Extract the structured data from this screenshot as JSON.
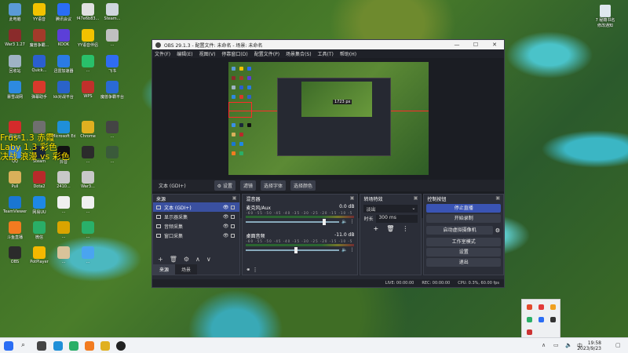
{
  "desktop": {
    "icons": [
      {
        "label": "此电脑",
        "color": "#5a9ad6"
      },
      {
        "label": "YY语音",
        "color": "#f2c200"
      },
      {
        "label": "腾讯会议",
        "color": "#2a6df4"
      },
      {
        "label": "f47e6b83...",
        "color": "#e0e0e0"
      },
      {
        "label": "Steam...",
        "color": "#cfd6dd"
      },
      {
        "label": "War3 1.27",
        "color": "#8a2b2b"
      },
      {
        "label": "魔兽争霸...",
        "color": "#a33a2a"
      },
      {
        "label": "KOOK",
        "color": "#5c3fd8"
      },
      {
        "label": "YY语音伴侣",
        "color": "#f2c200"
      },
      {
        "label": "...",
        "color": "#c0c0c0"
      },
      {
        "label": "回收站",
        "color": "#9fb3c4"
      },
      {
        "label": "Quick...",
        "color": "#2b5fcf"
      },
      {
        "label": "迅雷加速器",
        "color": "#2a7be4"
      },
      {
        "label": "...",
        "color": "#29c06a"
      },
      {
        "label": "飞书",
        "color": "#2f6cf2"
      },
      {
        "label": "暴雪战网",
        "color": "#2d8ae0"
      },
      {
        "label": "弹幕助手",
        "color": "#d8392b"
      },
      {
        "label": "kk对战平台",
        "color": "#2a63c9"
      },
      {
        "label": "WPS",
        "color": "#c0302b"
      },
      {
        "label": "魔兽争霸平台",
        "color": "#2a6ad4"
      },
      {
        "label": "网易云",
        "color": "#d42b2b"
      },
      {
        "label": "...",
        "color": "#6f6f6f"
      },
      {
        "label": "Microsoft Edge",
        "color": "#1f8fd8"
      },
      {
        "label": "Chrome",
        "color": "#e0b020"
      },
      {
        "label": "...",
        "color": "#444"
      },
      {
        "label": "QQ",
        "color": "#3a8fe6"
      },
      {
        "label": "Steam",
        "color": "#1b2838"
      },
      {
        "label": "抖音",
        "color": "#111"
      },
      {
        "label": "...",
        "color": "#2b2b2b"
      },
      {
        "label": "...",
        "color": "#3a5a3a"
      },
      {
        "label": "Pull",
        "color": "#d9b05a"
      },
      {
        "label": "Dota2",
        "color": "#b82a2a"
      },
      {
        "label": "2410...",
        "color": "#c8c8c8"
      },
      {
        "label": "War3...",
        "color": "#c8c8c8"
      },
      {
        "label": "TeamViewer",
        "color": "#1a76d2"
      },
      {
        "label": "网易UU",
        "color": "#1e88e5"
      },
      {
        "label": "...",
        "color": "#f0f0f0"
      },
      {
        "label": "...",
        "color": "#f0f0f0"
      },
      {
        "label": "斗鱼直播",
        "color": "#f27b20"
      },
      {
        "label": "微信",
        "color": "#2aae67"
      },
      {
        "label": "...",
        "color": "#d9a400"
      },
      {
        "label": "...",
        "color": "#29b06a"
      },
      {
        "label": "OBS",
        "color": "#2b2b2b"
      },
      {
        "label": "PotPlayer",
        "color": "#f4b800"
      },
      {
        "label": "...",
        "color": "#d9c39a"
      },
      {
        "label": "...",
        "color": "#4aa4f0"
      }
    ],
    "overlay_lines": [
      "Frus 1.3 赤霞",
      "Laby 1.3 彩色",
      "决战 浪漫 vs 彩色"
    ],
    "recycle_label": "7 秘籍书名\n修改通知"
  },
  "obs": {
    "title": "OBS 29.1.3 - 配置文件: 未命名 - 场景: 未命名",
    "window_controls": [
      "—",
      "☐",
      "✕"
    ],
    "menu": [
      "文件(F)",
      "编辑(E)",
      "视图(V)",
      "停靠窗口(D)",
      "配置文件(P)",
      "场景集合(S)",
      "工具(T)",
      "帮助(H)"
    ],
    "preview_overlay_label": "1723 px",
    "source_toolbar": {
      "selected_source": "文本 (GDI+)",
      "settings": "⚙ 设置",
      "filters": "滤镜",
      "font": "选择字体",
      "color": "选择颜色"
    },
    "sources_dock": {
      "title": "来源",
      "items": [
        {
          "label": "文本 (GDI+)",
          "selected": true
        },
        {
          "label": "显示器采集",
          "selected": false
        },
        {
          "label": "音频采集",
          "selected": false
        },
        {
          "label": "窗口采集",
          "selected": false
        }
      ],
      "footer": [
        "+",
        "🗑",
        "⚙",
        "∧",
        "∨"
      ],
      "tabs": [
        "来源",
        "场景"
      ]
    },
    "mixer_dock": {
      "title": "混音器",
      "scale": "-60 -55 -50 -45 -40 -35 -30 -25 -20 -15 -10 -5 0",
      "channels": [
        {
          "name": "麦克风/Aux",
          "db": "0.0 dB",
          "level": 0.82
        },
        {
          "name": "桌面音频",
          "db": "-11.0 dB",
          "level": 0.52
        }
      ]
    },
    "transitions_dock": {
      "title": "转场特效",
      "transition": "淡出",
      "duration_label": "时长",
      "duration": "300 ms"
    },
    "controls_dock": {
      "title": "控制按钮",
      "buttons": [
        "停止直播",
        "开始录制",
        "启动虚拟摄像机",
        "工作室模式",
        "设置",
        "退出"
      ]
    },
    "status": {
      "live": "LIVE: 00:00:00",
      "rec": "REC: 00:00:00",
      "cpu": "CPU: 0.3%, 60.00 fps"
    }
  },
  "taskbar": {
    "time": "19:58",
    "date": "2023/9/23"
  },
  "colors": {
    "accent": "#3a54b4",
    "panel": "#2b2e38",
    "window": "#272a33"
  }
}
